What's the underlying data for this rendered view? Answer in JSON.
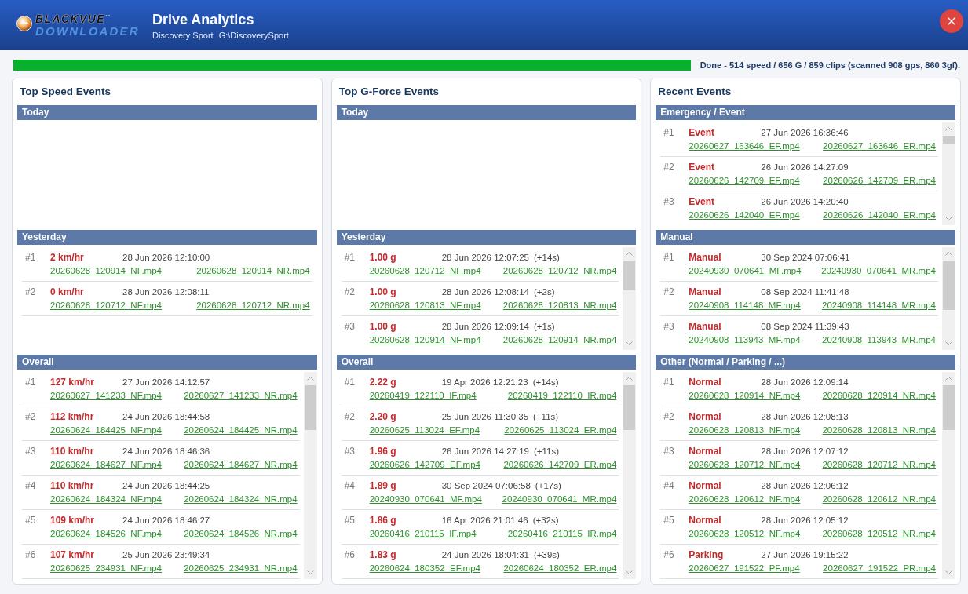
{
  "window": {
    "title": "Drive Analytics",
    "device": "Discovery Sport",
    "path": "G:\\DiscoverySport"
  },
  "logo": {
    "line_1": "BLACKVUE$^{™}$",
    "line_2": "DOWNLOADER"
  },
  "progress": {
    "level": 1,
    "status": "Done - 514 speed / 656 G / 859 clips (scanned 908 gps, 860 3gf)."
  },
  "panels": [
    {
      "title": "Top Speed Events",
      "sections": [
        {
          "title": "Today",
          "scrollbar": false
        },
        {
          "title": "Yesterday",
          "scrollbar": false,
          "rows": [
            {
              "rank": "#1",
              "value": "2 km/hr",
              "time": "28 Jun 2026 12:10:00",
              "front_file": "20260628_120914_NF.mp4",
              "rear_file": "20260628_120914_NR.mp4"
            },
            {
              "rank": "#2",
              "value": "0 km/hr",
              "time": "28 Jun 2026 12:08:11",
              "front_file": "20260628_120712_NF.mp4",
              "rear_file": "20260628_120712_NR.mp4"
            }
          ]
        },
        {
          "title": "Overall",
          "scrollbar": true,
          "rows": [
            {
              "rank": "#1",
              "value": "127 km/hr",
              "time": "27 Jun 2026 14:12:57",
              "front_file": "20260627_141233_NF.mp4",
              "rear_file": "20260627_141233_NR.mp4"
            },
            {
              "rank": "#2",
              "value": "112 km/hr",
              "time": "24 Jun 2026 18:44:58",
              "front_file": "20260624_184425_NF.mp4",
              "rear_file": "20260624_184425_NR.mp4"
            },
            {
              "rank": "#3",
              "value": "110 km/hr",
              "time": "24 Jun 2026 18:46:36",
              "front_file": "20260624_184627_NF.mp4",
              "rear_file": "20260624_184627_NR.mp4"
            },
            {
              "rank": "#4",
              "value": "110 km/hr",
              "time": "24 Jun 2026 18:44:25",
              "front_file": "20260624_184324_NF.mp4",
              "rear_file": "20260624_184324_NR.mp4"
            },
            {
              "rank": "#5",
              "value": "109 km/hr",
              "time": "24 Jun 2026 18:46:27",
              "front_file": "20260624_184526_NF.mp4",
              "rear_file": "20260624_184526_NR.mp4"
            },
            {
              "rank": "#6",
              "value": "107 km/hr",
              "time": "25 Jun 2026 23:49:34",
              "front_file": "20260625_234931_NF.mp4",
              "rear_file": "20260625_234931_NR.mp4"
            }
          ]
        }
      ]
    },
    {
      "title": "Top G-Force Events",
      "sections": [
        {
          "title": "Today",
          "scrollbar": false
        },
        {
          "title": "Yesterday",
          "scrollbar": true,
          "rows": [
            {
              "rank": "#1",
              "value": "1.00 g",
              "time": "28 Jun 2026 12:07:25",
              "offset": "(+14s)",
              "front_file": "20260628_120712_NF.mp4",
              "rear_file": "20260628_120712_NR.mp4"
            },
            {
              "rank": "#2",
              "value": "1.00 g",
              "time": "28 Jun 2026 12:08:14",
              "offset": "(+2s)",
              "front_file": "20260628_120813_NF.mp4",
              "rear_file": "20260628_120813_NR.mp4"
            },
            {
              "rank": "#3",
              "value": "1.00 g",
              "time": "28 Jun 2026 12:09:14",
              "offset": "(+1s)",
              "front_file": "20260628_120914_NF.mp4",
              "rear_file": "20260628_120914_NR.mp4"
            }
          ]
        },
        {
          "title": "Overall",
          "scrollbar": true,
          "rows": [
            {
              "rank": "#1",
              "value": "2.22 g",
              "time": "19 Apr 2026 12:21:23",
              "offset": "(+14s)",
              "front_file": "20260419_122110_IF.mp4",
              "rear_file": "20260419_122110_IR.mp4"
            },
            {
              "rank": "#2",
              "value": "2.20 g",
              "time": "25 Jun 2026 11:30:35",
              "offset": "(+11s)",
              "front_file": "20260625_113024_EF.mp4",
              "rear_file": "20260625_113024_ER.mp4"
            },
            {
              "rank": "#3",
              "value": "1.96 g",
              "time": "26 Jun 2026 14:27:19",
              "offset": "(+11s)",
              "front_file": "20260626_142709_EF.mp4",
              "rear_file": "20260626_142709_ER.mp4"
            },
            {
              "rank": "#4",
              "value": "1.89 g",
              "time": "30 Sep 2024 07:06:58",
              "offset": "(+17s)",
              "front_file": "20240930_070641_MF.mp4",
              "rear_file": "20240930_070641_MR.mp4"
            },
            {
              "rank": "#5",
              "value": "1.86 g",
              "time": "16 Apr 2026 21:01:46",
              "offset": "(+32s)",
              "front_file": "20260416_210115_IF.mp4",
              "rear_file": "20260416_210115_IR.mp4"
            },
            {
              "rank": "#6",
              "value": "1.83 g",
              "time": "24 Jun 2026 18:04:31",
              "offset": "(+39s)",
              "front_file": "20260624_180352_EF.mp4",
              "rear_file": "20260624_180352_ER.mp4"
            }
          ]
        }
      ]
    },
    {
      "title": "Recent Events",
      "sections": [
        {
          "title": "Emergency / Event",
          "scrollbar": true,
          "rows": [
            {
              "rank": "#1",
              "value": "Event",
              "time": "27 Jun 2026 16:36:46",
              "front_file": "20260627_163646_EF.mp4",
              "rear_file": "20260627_163646_ER.mp4"
            },
            {
              "rank": "#2",
              "value": "Event",
              "time": "26 Jun 2026 14:27:09",
              "front_file": "20260626_142709_EF.mp4",
              "rear_file": "20260626_142709_ER.mp4"
            },
            {
              "rank": "#3",
              "value": "Event",
              "time": "26 Jun 2026 14:20:40",
              "front_file": "20260626_142040_EF.mp4",
              "rear_file": "20260626_142040_ER.mp4"
            }
          ]
        },
        {
          "title": "Manual",
          "scrollbar": true,
          "rows": [
            {
              "rank": "#1",
              "value": "Manual",
              "time": "30 Sep 2024 07:06:41",
              "front_file": "20240930_070641_MF.mp4",
              "rear_file": "20240930_070641_MR.mp4"
            },
            {
              "rank": "#2",
              "value": "Manual",
              "time": "08 Sep 2024 11:41:48",
              "front_file": "20240908_114148_MF.mp4",
              "rear_file": "20240908_114148_MR.mp4"
            },
            {
              "rank": "#3",
              "value": "Manual",
              "time": "08 Sep 2024 11:39:43",
              "front_file": "20240908_113943_MF.mp4",
              "rear_file": "20240908_113943_MR.mp4"
            }
          ]
        },
        {
          "title": "Other (Normal / Parking / ...)",
          "scrollbar": true,
          "rows": [
            {
              "rank": "#1",
              "value": "Normal",
              "time": "28 Jun 2026 12:09:14",
              "front_file": "20260628_120914_NF.mp4",
              "rear_file": "20260628_120914_NR.mp4"
            },
            {
              "rank": "#2",
              "value": "Normal",
              "time": "28 Jun 2026 12:08:13",
              "front_file": "20260628_120813_NF.mp4",
              "rear_file": "20260628_120813_NR.mp4"
            },
            {
              "rank": "#3",
              "value": "Normal",
              "time": "28 Jun 2026 12:07:12",
              "front_file": "20260628_120712_NF.mp4",
              "rear_file": "20260628_120712_NR.mp4"
            },
            {
              "rank": "#4",
              "value": "Normal",
              "time": "28 Jun 2026 12:06:12",
              "front_file": "20260628_120612_NF.mp4",
              "rear_file": "20260628_120612_NR.mp4"
            },
            {
              "rank": "#5",
              "value": "Normal",
              "time": "28 Jun 2026 12:05:12",
              "front_file": "20260628_120512_NF.mp4",
              "rear_file": "20260628_120512_NR.mp4"
            },
            {
              "rank": "#6",
              "value": "Parking",
              "time": "27 Jun 2026 19:15:22",
              "front_file": "20260627_191522_PF.mp4",
              "rear_file": "20260627_191522_PR.mp4"
            }
          ]
        }
      ]
    }
  ]
}
